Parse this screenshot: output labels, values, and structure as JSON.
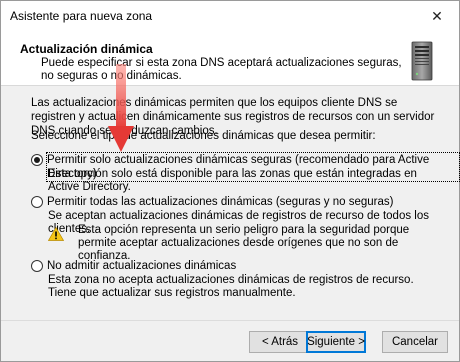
{
  "window": {
    "title": "Asistente para nueva zona",
    "close_glyph": "✕"
  },
  "header": {
    "title": "Actualización dinámica",
    "description": "Puede especificar si esta zona DNS aceptará actualizaciones seguras, no seguras o no dinámicas.",
    "icon": "server-icon"
  },
  "content": {
    "intro": "Las actualizaciones dinámicas permiten que los equipos cliente DNS se registren y actualicen dinámicamente sus registros de recursos con un servidor DNS cuando se produzcan cambios.",
    "prompt": "Seleccione el tipo de actualizaciones dinámicas que desea permitir:",
    "options": [
      {
        "label": "Permitir solo actualizaciones dinámicas seguras (recomendado para Active Directory)",
        "underline_char": "P",
        "description": "Esta opción solo está disponible para las zonas que están integradas en Active Directory.",
        "selected": true
      },
      {
        "label": "Permitir todas las actualizaciones dinámicas (seguras y no seguras)",
        "underline_char": "P",
        "description": "Se aceptan actualizaciones dinámicas de registros de recurso de todos los clientes.",
        "warning": "Esta opción representa un serio peligro para la seguridad porque permite aceptar actualizaciones desde orígenes que no son de confianza.",
        "selected": false
      },
      {
        "label": "No admitir actualizaciones dinámicas",
        "underline_char": "N",
        "description": "Esta zona no acepta actualizaciones dinámicas de registros de recurso. Tiene que actualizar sus registros manualmente.",
        "selected": false
      }
    ]
  },
  "footer": {
    "back_label": "< Atrás",
    "next_label": "Siguiente >",
    "cancel_label": "Cancelar"
  },
  "annotation": {
    "arrow_color": "#e53935"
  },
  "colors": {
    "focus_border": "#0078d7",
    "warning_yellow": "#f5c518"
  }
}
